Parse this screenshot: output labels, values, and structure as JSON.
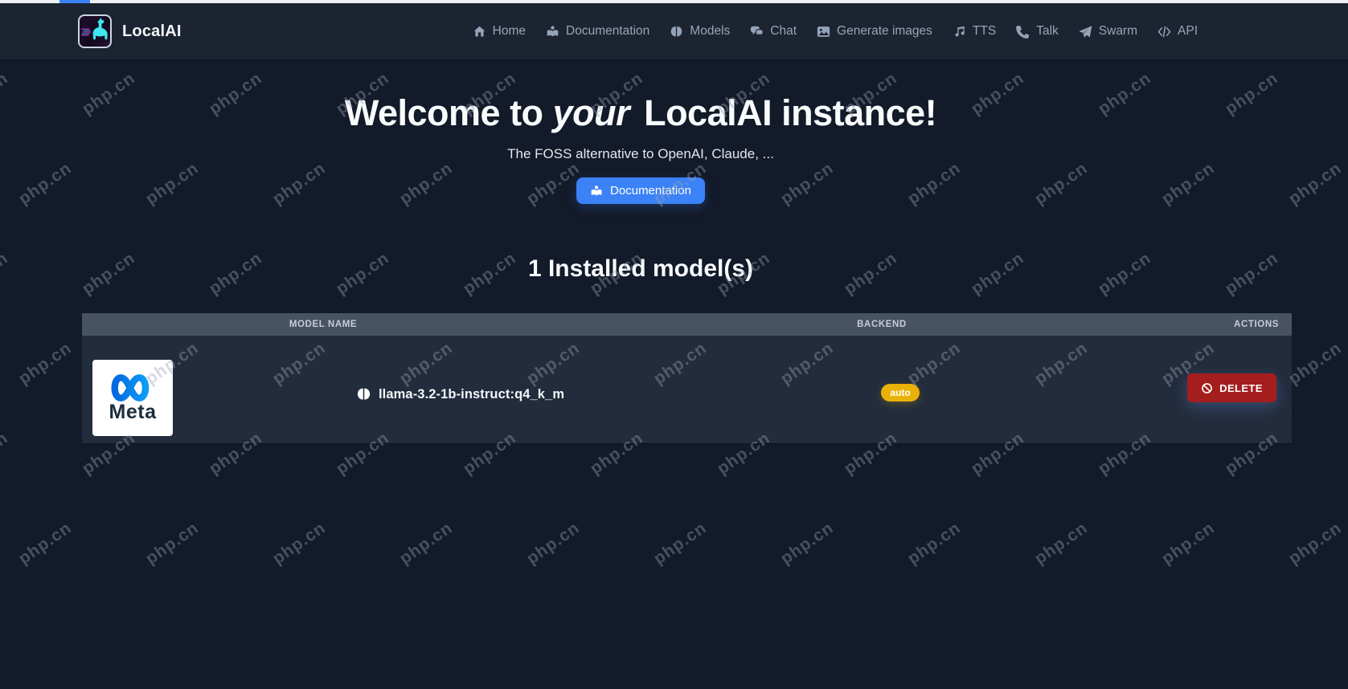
{
  "navbar": {
    "brand_title": "LocalAI",
    "items": [
      {
        "label": "Home"
      },
      {
        "label": "Documentation"
      },
      {
        "label": "Models"
      },
      {
        "label": "Chat"
      },
      {
        "label": "Generate images"
      },
      {
        "label": "TTS"
      },
      {
        "label": "Talk"
      },
      {
        "label": "Swarm"
      },
      {
        "label": "API"
      }
    ]
  },
  "hero": {
    "title_prefix": "Welcome to ",
    "title_emphasis": "your",
    "title_suffix": " LocalAI instance!",
    "subtitle": "The FOSS alternative to OpenAI, Claude, ...",
    "docs_button": "Documentation"
  },
  "models": {
    "heading": "1 Installed model(s)",
    "columns": [
      "MODEL NAME",
      "BACKEND",
      "ACTIONS"
    ],
    "rows": [
      {
        "avatar_label": "Meta",
        "name": "llama-3.2-1b-instruct:q4_k_m",
        "backend": "auto",
        "action": "DELETE"
      }
    ]
  },
  "watermark": {
    "text": "php.cn"
  },
  "colors": {
    "accent_blue": "#3b82f6",
    "badge_yellow": "#e9b209",
    "delete_red": "#a41e1e",
    "navbar_bg": "#1c2432",
    "page_bg": "#131a29",
    "table_header_bg": "#475262",
    "row_bg": "#222c3c"
  }
}
